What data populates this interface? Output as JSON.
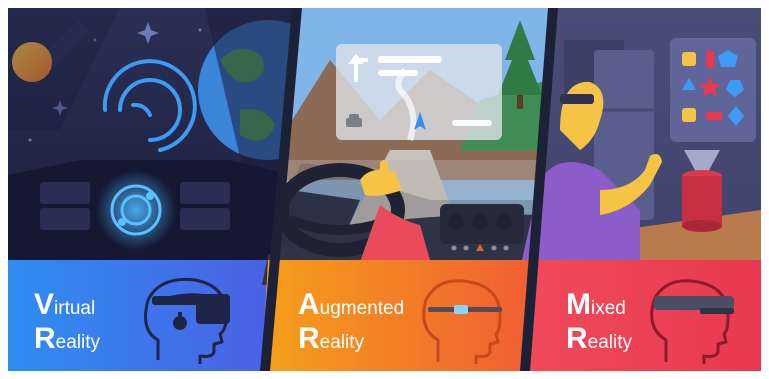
{
  "panels": [
    {
      "id": "vr",
      "initial_top": "V",
      "rest_top": "irtual",
      "initial_bottom": "R",
      "rest_bottom": "eality",
      "color_start": "#2f8df0",
      "color_end": "#4b5ce3"
    },
    {
      "id": "ar",
      "initial_top": "A",
      "rest_top": "ugmented",
      "initial_bottom": "R",
      "rest_bottom": "eality",
      "color_start": "#f39a1c",
      "color_end": "#f05d34"
    },
    {
      "id": "mr",
      "initial_top": "M",
      "rest_top": "ixed",
      "initial_bottom": "R",
      "rest_bottom": "eality",
      "color_start": "#f2495a",
      "color_end": "#e63950"
    }
  ],
  "icons": {
    "vr_head": "vr-headset-head-icon",
    "ar_head": "smart-glasses-head-icon",
    "mr_head": "mixed-reality-headset-head-icon"
  }
}
